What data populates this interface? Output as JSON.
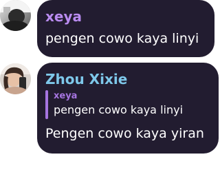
{
  "colors": {
    "bubble_bg": "#221c30",
    "sender_1": "#b98bf0",
    "sender_2": "#7ec8ea",
    "reply_accent": "#a675e0",
    "text": "#ffffff"
  },
  "messages": [
    {
      "sender": "xeya",
      "avatar_icon": "user-avatar-photo",
      "text": "pengen cowo kaya linyi"
    },
    {
      "sender": "Zhou Xixie",
      "avatar_icon": "user-avatar-photo",
      "reply": {
        "sender": "xeya",
        "text": "pengen cowo kaya linyi"
      },
      "text": "Pengen cowo kaya yiran"
    }
  ]
}
